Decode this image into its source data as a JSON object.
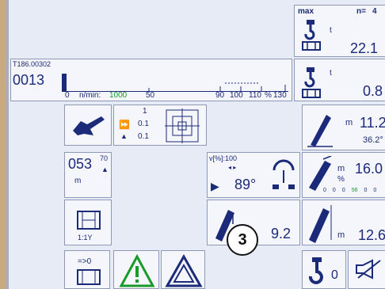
{
  "top_right": {
    "max_label": "max",
    "n_label": "n=",
    "n_value": "4",
    "unit_t": "t",
    "load_value": "22.1"
  },
  "ident": {
    "code": "T186.00302",
    "counter": "0013"
  },
  "scale": {
    "zero": "0",
    "rate_label": "n/min:",
    "rate_value": "1000",
    "mark_50": "50",
    "mark_90": "90",
    "mark_100": "100",
    "mark_110": "110",
    "pct": "%",
    "mark_130": "130",
    "fill_fraction": 0.02
  },
  "load2": {
    "unit_t": "t",
    "value": "0.8"
  },
  "slew": {
    "val1": "1",
    "val2": "0.1",
    "val3": "0.1"
  },
  "radius": {
    "unit": "m",
    "value": "11.2",
    "angle": "36.2°"
  },
  "position": {
    "value": "053",
    "superscript": "70",
    "unit": "m"
  },
  "wind": {
    "label": "v[%]:100",
    "angle": "89°"
  },
  "boom": {
    "unit_m": "m",
    "unit_pct": "%",
    "value": "16.0",
    "scale": [
      "0",
      "0",
      "0",
      "56",
      "0",
      "0"
    ]
  },
  "reeving": {
    "label": "1:1Y"
  },
  "small_load": {
    "value": "9.2"
  },
  "height": {
    "unit": "m",
    "value": "12.6"
  },
  "bottom": {
    "hook_value": "0",
    "drum_label": "=>0"
  },
  "overlay": {
    "badge": "3"
  },
  "colors": {
    "navy": "#1c2a7a",
    "green": "#1a9a2a",
    "panel": "#f4f6fb"
  }
}
